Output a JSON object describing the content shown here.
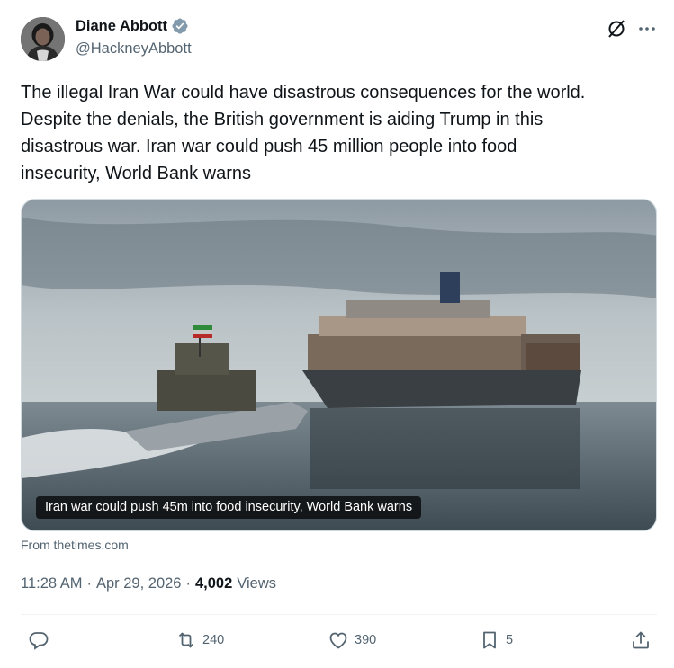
{
  "author": {
    "name": "Diane Abbott",
    "handle": "@HackneyAbbott"
  },
  "tweet": {
    "text": "The illegal Iran War could have disastrous consequences for the world.\nDespite the denials, the British government is aiding Trump in this\ndisastrous war. Iran war could push 45 million people into food\ninsecurity, World Bank warns"
  },
  "card": {
    "caption": "Iran war could push 45m into food insecurity, World Bank warns",
    "source": "From thetimes.com"
  },
  "meta": {
    "time": "11:28 AM",
    "date": "Apr 29, 2026",
    "views_count": "4,002",
    "views_label": "Views",
    "separator": "·"
  },
  "actions": {
    "retweets": "240",
    "likes": "390",
    "bookmarks": "5"
  },
  "icons": [
    "verified-icon",
    "grok-icon",
    "more-icon",
    "reply-icon",
    "retweet-icon",
    "like-icon",
    "bookmark-icon",
    "share-icon"
  ],
  "colors": {
    "text_primary": "#0f1419",
    "text_secondary": "#536471",
    "verified": "#829aab",
    "divider": "#eff3f4"
  }
}
